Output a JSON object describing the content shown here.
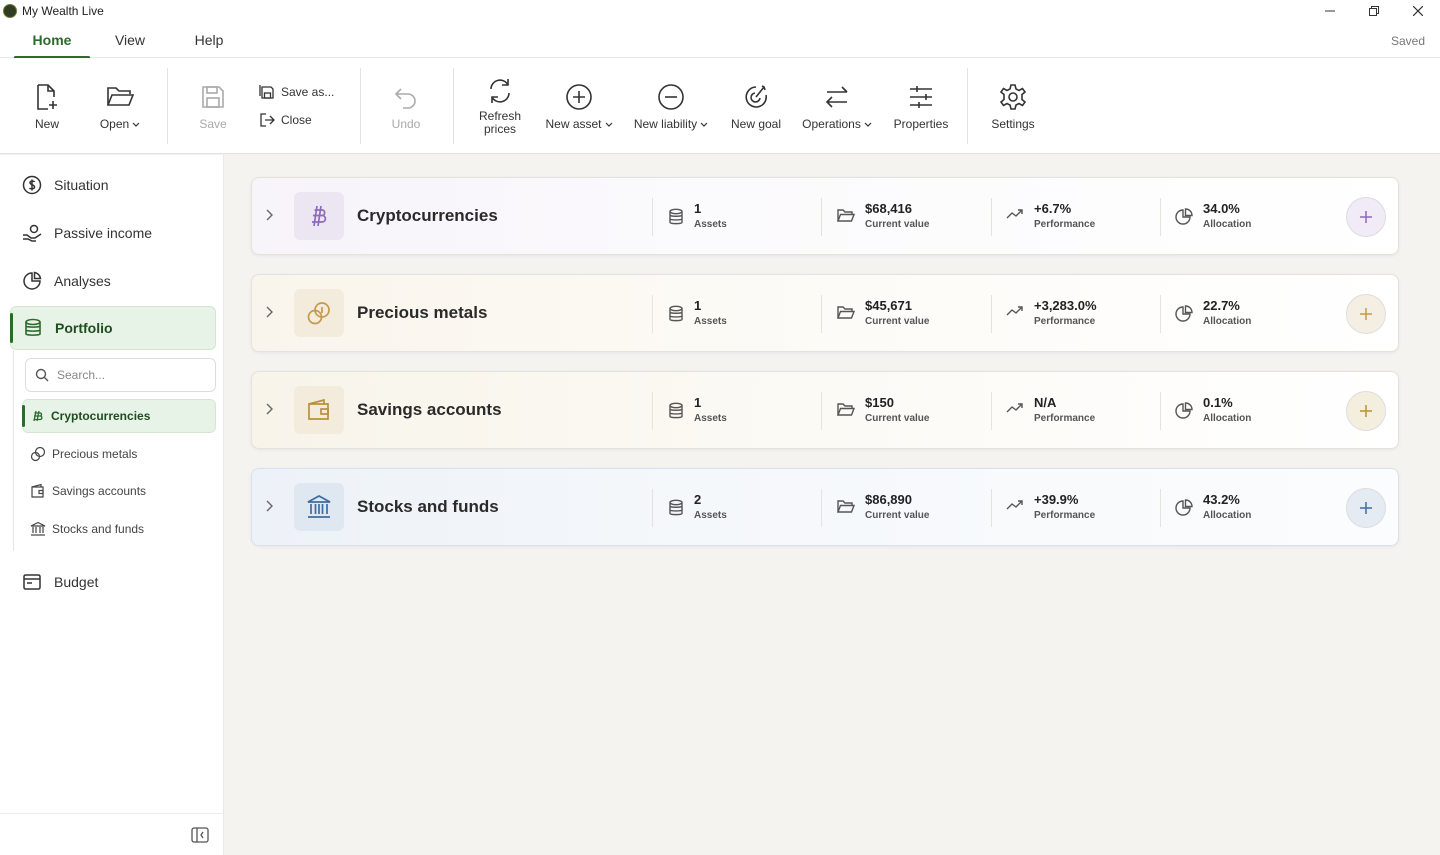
{
  "window": {
    "title": "My Wealth Live",
    "minimize_icon": "minimize-icon",
    "restore_icon": "restore-icon",
    "close_icon": "close-icon"
  },
  "tabs": [
    {
      "label": "Home",
      "active": true
    },
    {
      "label": "View"
    },
    {
      "label": "Help"
    }
  ],
  "status": "Saved",
  "toolbar": {
    "new": "New",
    "open": "Open",
    "save": "Save",
    "save_as": "Save as...",
    "close": "Close",
    "undo": "Undo",
    "refresh_line1": "Refresh",
    "refresh_line2": "prices",
    "new_asset": "New asset",
    "new_liability": "New liability",
    "new_goal": "New goal",
    "operations": "Operations",
    "properties": "Properties",
    "settings": "Settings"
  },
  "sidebar": {
    "items": [
      {
        "label": "Situation",
        "icon": "dollar-circle-icon"
      },
      {
        "label": "Passive income",
        "icon": "hand-coin-icon"
      },
      {
        "label": "Analyses",
        "icon": "pie-chart-icon"
      },
      {
        "label": "Portfolio",
        "icon": "database-icon",
        "active": true
      },
      {
        "label": "Budget",
        "icon": "wallet-icon"
      }
    ],
    "search_placeholder": "Search...",
    "sub_items": [
      {
        "label": "Cryptocurrencies",
        "icon": "bitcoin-icon",
        "active": true
      },
      {
        "label": "Precious metals",
        "icon": "coins-icon"
      },
      {
        "label": "Savings accounts",
        "icon": "wallet-icon"
      },
      {
        "label": "Stocks and funds",
        "icon": "bank-icon"
      }
    ]
  },
  "labels": {
    "assets": "Assets",
    "current_value": "Current value",
    "performance": "Performance",
    "allocation": "Allocation"
  },
  "categories": [
    {
      "name": "Cryptocurrencies",
      "assets": "1",
      "current_value": "$68,416",
      "performance": "+6.7%",
      "allocation": "34.0%",
      "accent": "#8e6bb8"
    },
    {
      "name": "Precious metals",
      "assets": "1",
      "current_value": "$45,671",
      "performance": "+3,283.0%",
      "allocation": "22.7%",
      "accent": "#c49a4a"
    },
    {
      "name": "Savings accounts",
      "assets": "1",
      "current_value": "$150",
      "performance": "N/A",
      "allocation": "0.1%",
      "accent": "#b8913a"
    },
    {
      "name": "Stocks and funds",
      "assets": "2",
      "current_value": "$86,890",
      "performance": "+39.9%",
      "allocation": "43.2%",
      "accent": "#3f6c9e"
    }
  ],
  "colors": {
    "brand_green": "#2d6a2e"
  }
}
